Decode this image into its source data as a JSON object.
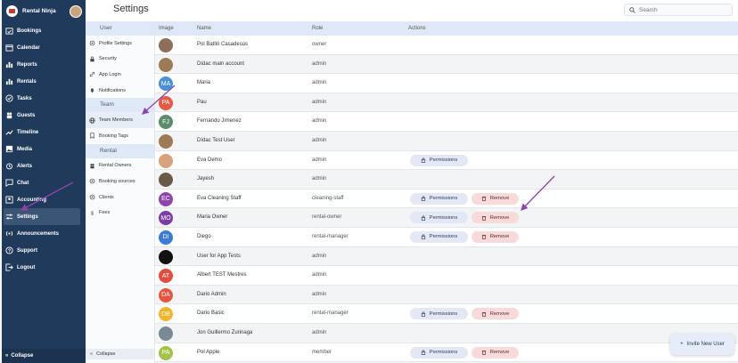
{
  "colors": {
    "nav_bg": "#1f3a5a",
    "accent": "#dfe8f7",
    "arrow": "#8e44ad",
    "permissions_bg": "#e3e8f4",
    "remove_bg": "#f8dada"
  },
  "nav": {
    "brand": "Rental Ninja",
    "items": [
      {
        "label": "Bookings",
        "icon": "calendar-check-icon"
      },
      {
        "label": "Calendar",
        "icon": "calendar-icon"
      },
      {
        "label": "Reports",
        "icon": "bar-chart-icon"
      },
      {
        "label": "Rentals",
        "icon": "bar-chart-icon"
      },
      {
        "label": "Tasks",
        "icon": "check-circle-icon"
      },
      {
        "label": "Guests",
        "icon": "people-icon"
      },
      {
        "label": "Timeline",
        "icon": "trend-line-icon"
      },
      {
        "label": "Media",
        "icon": "image-icon"
      },
      {
        "label": "Alerts",
        "icon": "alarm-icon"
      },
      {
        "label": "Chat",
        "icon": "chat-icon"
      },
      {
        "label": "Accounting",
        "icon": "account-icon"
      },
      {
        "label": "Settings",
        "icon": "sliders-icon"
      },
      {
        "label": "Announcements",
        "icon": "broadcast-icon"
      },
      {
        "label": "Support",
        "icon": "question-icon"
      },
      {
        "label": "Logout",
        "icon": "logout-icon"
      }
    ],
    "collapse": "Collapse"
  },
  "sub": {
    "user_section": "User",
    "user_items": [
      {
        "label": "Profile Settings",
        "icon": "settings-icon"
      },
      {
        "label": "Security",
        "icon": "lock-icon"
      },
      {
        "label": "App Login",
        "icon": "link-icon"
      },
      {
        "label": "Notifications",
        "icon": "bell-icon"
      }
    ],
    "team_section": "Team",
    "team_items": [
      {
        "label": "Team Members",
        "icon": "globe-icon"
      },
      {
        "label": "Booking Tags",
        "icon": "bookmark-icon"
      }
    ],
    "rental_section": "Rental",
    "rental_items": [
      {
        "label": "Rental Owners",
        "icon": "people-icon"
      },
      {
        "label": "Booking sources",
        "icon": "settings-icon"
      },
      {
        "label": "Clients",
        "icon": "settings-icon"
      },
      {
        "label": "Fees",
        "icon": "dollar-icon"
      }
    ],
    "collapse": "Collapse"
  },
  "header": {
    "title": "Settings",
    "search_placeholder": "Search"
  },
  "table": {
    "columns": [
      "Image",
      "Name",
      "Role",
      "Actions"
    ],
    "permissions_label": "Permissions",
    "remove_label": "Remove",
    "rows": [
      {
        "name": "Pol Batlló Casadesús",
        "role": "owner",
        "initials": "",
        "color": "#8d6e5a",
        "permissions": false,
        "remove": false
      },
      {
        "name": "Dídac main account",
        "role": "admin",
        "initials": "",
        "color": "#9c7a55",
        "permissions": false,
        "remove": false
      },
      {
        "name": "Maria",
        "role": "admin",
        "initials": "MA",
        "color": "#4a90d9",
        "permissions": false,
        "remove": false
      },
      {
        "name": "Pau",
        "role": "admin",
        "initials": "PA",
        "color": "#e25b45",
        "permissions": false,
        "remove": false
      },
      {
        "name": "Fernando Jimenez",
        "role": "admin",
        "initials": "FJ",
        "color": "#5b8c6a",
        "permissions": false,
        "remove": false
      },
      {
        "name": "Dídac Test User",
        "role": "admin",
        "initials": "",
        "color": "#9c7a55",
        "permissions": false,
        "remove": false
      },
      {
        "name": "Eva Demo",
        "role": "admin",
        "initials": "",
        "color": "#d9a27a",
        "permissions": true,
        "remove": false
      },
      {
        "name": "Jayesh",
        "role": "admin",
        "initials": "",
        "color": "#6b5a4a",
        "permissions": false,
        "remove": false
      },
      {
        "name": "Eva Cleaning Staff",
        "role": "cleaning-staff",
        "initials": "EC",
        "color": "#8e44ad",
        "permissions": true,
        "remove": true
      },
      {
        "name": "Maria Owner",
        "role": "rental-owner",
        "initials": "MO",
        "color": "#7b3fa3",
        "permissions": true,
        "remove": true
      },
      {
        "name": "Diego",
        "role": "rental-manager",
        "initials": "DI",
        "color": "#3a7bd5",
        "permissions": true,
        "remove": true
      },
      {
        "name": "User for App Tests",
        "role": "admin",
        "initials": "",
        "color": "#111111",
        "permissions": false,
        "remove": false
      },
      {
        "name": "Albert TEST Mestres",
        "role": "admin",
        "initials": "AT",
        "color": "#e04e3f",
        "permissions": false,
        "remove": false
      },
      {
        "name": "Dario Admin",
        "role": "admin",
        "initials": "DA",
        "color": "#e8553f",
        "permissions": false,
        "remove": false
      },
      {
        "name": "Dario Basic",
        "role": "rental-manager",
        "initials": "DB",
        "color": "#f0b429",
        "permissions": true,
        "remove": true
      },
      {
        "name": "Jon Guillermo Zurinaga",
        "role": "admin",
        "initials": "",
        "color": "#7a8a95",
        "permissions": false,
        "remove": false
      },
      {
        "name": "Pol Apple",
        "role": "member",
        "initials": "PA",
        "color": "#a5c34a",
        "permissions": true,
        "remove": true
      }
    ]
  },
  "invite_label": "Invite New User"
}
